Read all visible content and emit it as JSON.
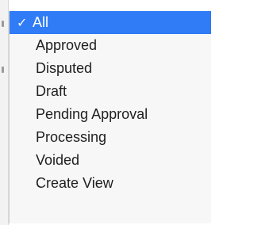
{
  "menu": {
    "items": [
      {
        "label": "All",
        "checked": true,
        "check_glyph": "✓"
      },
      {
        "label": "Approved",
        "checked": false
      },
      {
        "label": "Disputed",
        "checked": false
      },
      {
        "label": "Draft",
        "checked": false
      },
      {
        "label": "Pending Approval",
        "checked": false
      },
      {
        "label": "Processing",
        "checked": false
      },
      {
        "label": "Voided",
        "checked": false
      },
      {
        "label": "Create View",
        "checked": false
      }
    ],
    "selected_bg_color": "#2f7cf6",
    "selected_text_color": "#ffffff",
    "item_text_color": "#1f1f1f"
  }
}
